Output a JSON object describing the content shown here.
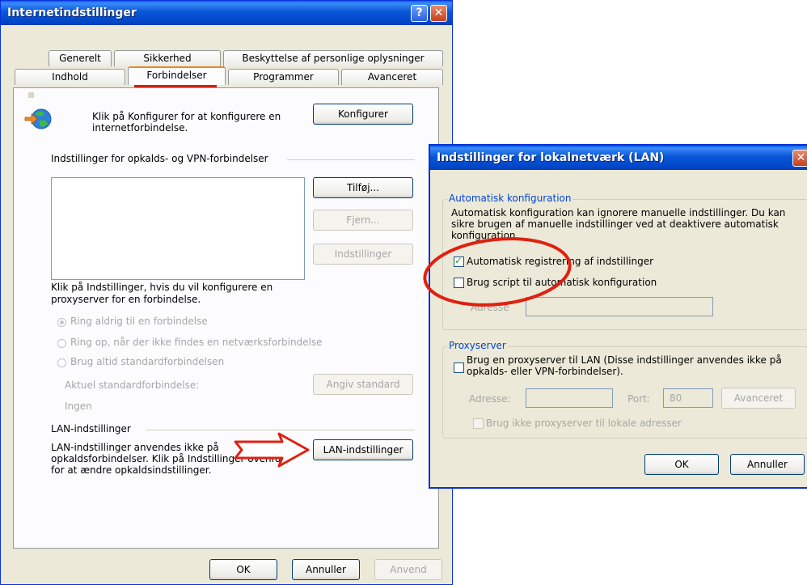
{
  "main": {
    "title": "Internetindstillinger",
    "help_glyph": "?",
    "close_glyph": "✕",
    "tabs_row1": [
      "Generelt",
      "Sikkerhed",
      "Beskyttelse af personlige oplysninger"
    ],
    "tabs_row2": [
      "Indhold",
      "Forbindelser",
      "Programmer",
      "Avanceret"
    ],
    "active_tab": "Forbindelser",
    "setup_text": "Klik på Konfigurer for at konfigurere en internetforbindelse.",
    "configure_button": "Konfigurer",
    "dialup_heading": "Indstillinger for opkalds- og VPN-forbindelser",
    "add_button": "Tilføj...",
    "remove_button": "Fjern...",
    "settings_button": "Indstillinger",
    "proxy_text": "Klik på Indstillinger, hvis du vil konfigurere en proxyserver for en forbindelse.",
    "radio_never": "Ring aldrig til en forbindelse",
    "radio_when_none": "Ring op, når der ikke findes en netværksforbindelse",
    "radio_always": "Brug altid standardforbindelsen",
    "current_default_label": "Aktuel standardforbindelse:",
    "current_default_value": "Ingen",
    "set_default_button": "Angiv standard",
    "lan_heading": "LAN-indstillinger",
    "lan_text": "LAN-indstillinger anvendes ikke på opkaldsforbindelser. Klik på Indstillinger ovenfor for at ændre opkaldsindstillinger.",
    "lan_button": "LAN-indstillinger",
    "ok_button": "OK",
    "cancel_button": "Annuller",
    "apply_button": "Anvend"
  },
  "lan": {
    "title": "Indstillinger for lokalnetværk (LAN)",
    "close_glyph": "✕",
    "auto_group": "Automatisk konfiguration",
    "auto_text": "Automatisk konfiguration kan ignorere manuelle indstillinger. Du kan sikre brugen af manuelle indstillinger ved at deaktivere automatisk konfiguration.",
    "auto_detect_label": "Automatisk registrering af indstillinger",
    "auto_detect_checked": true,
    "script_label": "Brug script til automatisk konfiguration",
    "script_checked": false,
    "address_label": "Adresse",
    "proxy_group": "Proxyserver",
    "proxy_label": "Brug en proxyserver til LAN (Disse indstillinger anvendes ikke på opkalds- eller VPN-forbindelser).",
    "proxy_checked": false,
    "proxy_address_label": "Adresse:",
    "port_label": "Port:",
    "port_value": "80",
    "advanced_button": "Avanceret",
    "bypass_label": "Brug ikke proxyserver til lokale adresser",
    "ok_button": "OK",
    "cancel_button": "Annuller"
  },
  "colors": {
    "title_bar": "#0a56d8",
    "annotation_red": "#e02010",
    "group_label": "#0046d5"
  },
  "icons": [
    "globe-icon",
    "arrow-annotation-icon",
    "circle-annotation"
  ]
}
